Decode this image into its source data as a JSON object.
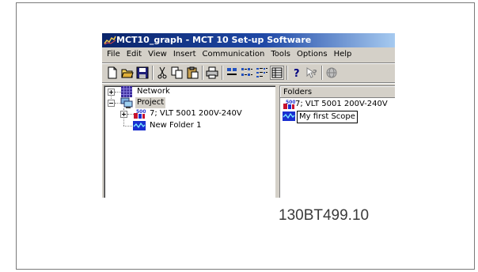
{
  "window": {
    "title": "MCT10_graph - MCT 10 Set-up Software"
  },
  "menu": [
    "File",
    "Edit",
    "View",
    "Insert",
    "Communication",
    "Tools",
    "Options",
    "Help"
  ],
  "toolbar": {
    "buttons": [
      "new-icon",
      "open-folder-icon",
      "save-icon",
      "cut-icon",
      "copy-icon",
      "paste-icon",
      "print-icon",
      "large-icons-icon",
      "small-icons-icon",
      "list-icon",
      "details-icon",
      "help-icon",
      "context-help-icon",
      "globe-icon"
    ]
  },
  "tree": {
    "items": [
      {
        "label": "Network",
        "icon": "network-grid-icon",
        "expander": "+"
      },
      {
        "label": "Project",
        "icon": "project-computer-icon",
        "expander": "-"
      },
      {
        "label": "7; VLT 5001 200V-240V",
        "icon": "drive-icon",
        "expander": "+"
      },
      {
        "label": "New Folder 1",
        "icon": "scope-icon"
      }
    ]
  },
  "folders": {
    "header": "Folders",
    "items": [
      {
        "label": "7; VLT 5001 200V-240V",
        "icon": "drive-icon"
      },
      {
        "label": "My first Scope",
        "icon": "scope-icon"
      }
    ]
  },
  "figure_code": "130BT499.10",
  "colors": {
    "titlebar": "#0a246a",
    "chrome": "#d4d0c8",
    "scope_blue": "#1a2fd0",
    "drive_red": "#c8102e"
  }
}
